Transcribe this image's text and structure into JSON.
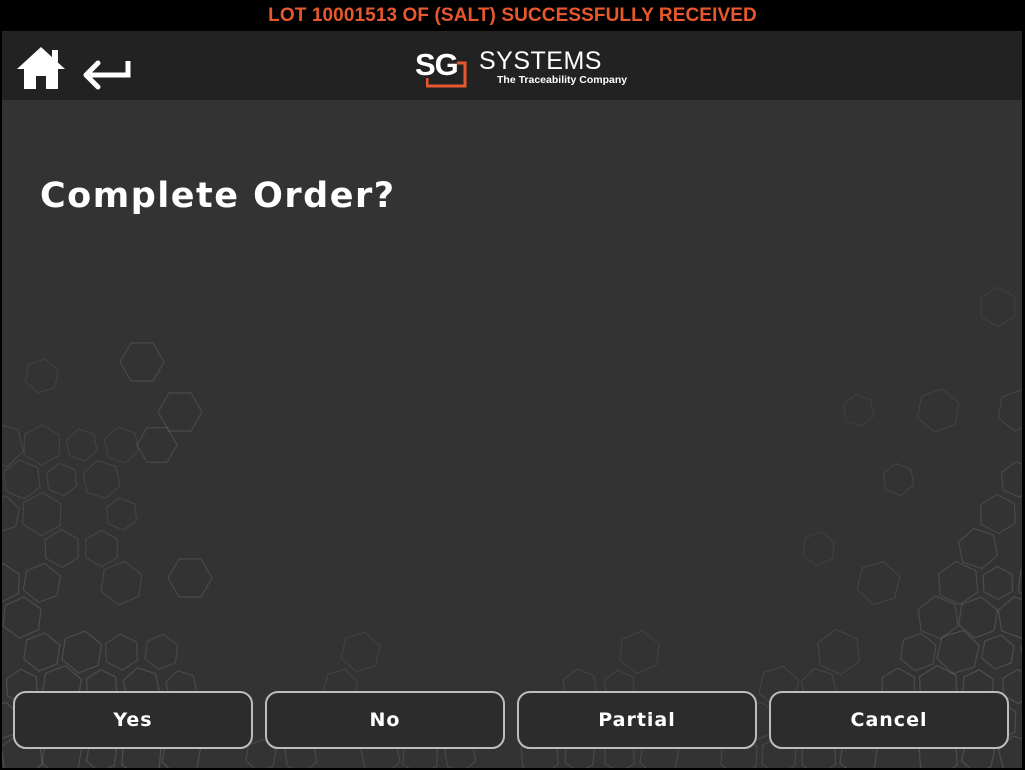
{
  "status_message": "LOT 10001513 OF (SALT) SUCCESSFULLY RECEIVED",
  "header": {
    "home_icon": "home-icon",
    "back_icon": "back-arrow-icon",
    "logo": {
      "mark": "SG",
      "name": "SYSTEMS",
      "tagline": "The Traceability Company"
    }
  },
  "dialog": {
    "title": "Complete Order?"
  },
  "buttons": {
    "yes": "Yes",
    "no": "No",
    "partial": "Partial",
    "cancel": "Cancel"
  },
  "colors": {
    "status_text": "#e8582e",
    "logo_accent": "#e8582e",
    "header_bg": "#222222",
    "main_bg": "#333333",
    "button_border": "#bdbdbd"
  }
}
